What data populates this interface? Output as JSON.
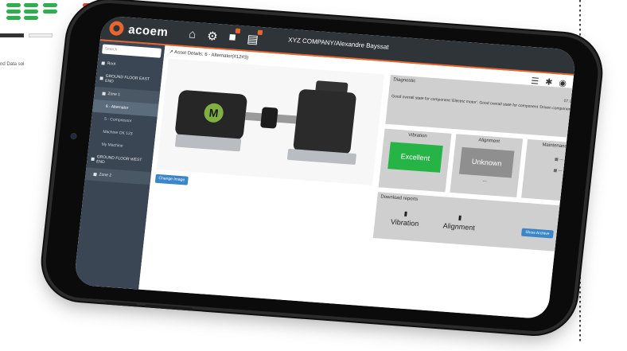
{
  "brand": {
    "name": "acoem",
    "accent": "#e8662e"
  },
  "header": {
    "company_user": "XYZ COMPANY/Alexandre Bayssat",
    "nav_icons": [
      "home-icon",
      "assets-icon",
      "factory-icon",
      "reports-icon"
    ]
  },
  "sidebar": {
    "search_placeholder": "Search",
    "items": [
      {
        "label": "Root",
        "level": 0
      },
      {
        "label": "GROUND FLOOR EAST END",
        "level": 0
      },
      {
        "label": "Zone 1",
        "level": 1
      },
      {
        "label": "6 - Alternator",
        "level": 2,
        "active": true
      },
      {
        "label": "5 - Compressor",
        "level": 2
      },
      {
        "label": "Machine OK 123",
        "level": 2
      },
      {
        "label": "My Machine",
        "level": 2
      },
      {
        "label": "GROUND FLOOR WEST END",
        "level": 0
      },
      {
        "label": "Zone 2",
        "level": 1
      }
    ]
  },
  "asset": {
    "title": "Asset Details: 6 - Alternator(#12#3)",
    "motor_label": "M",
    "change_image_label": "Change Image"
  },
  "diagnostic": {
    "title": "Diagnostic",
    "date": "07.01.2020 15:05",
    "text": "Good overall state for component 'Electric motor'. Good overall state for component 'Driven component'."
  },
  "vibration": {
    "title": "Vibration",
    "status": "Excellent",
    "color": "#27b447"
  },
  "alignment": {
    "title": "Alignment",
    "status": "Unknown",
    "sub": "---",
    "color": "#8f8f8f"
  },
  "maintenance": {
    "title": "Maintenance due",
    "line1": "---",
    "line2": "---"
  },
  "reports": {
    "title": "Download reports",
    "items": [
      "Vibration",
      "Alignment"
    ],
    "show_archive_label": "Show Archive"
  },
  "background": {
    "side_text": "nd Data sol"
  }
}
